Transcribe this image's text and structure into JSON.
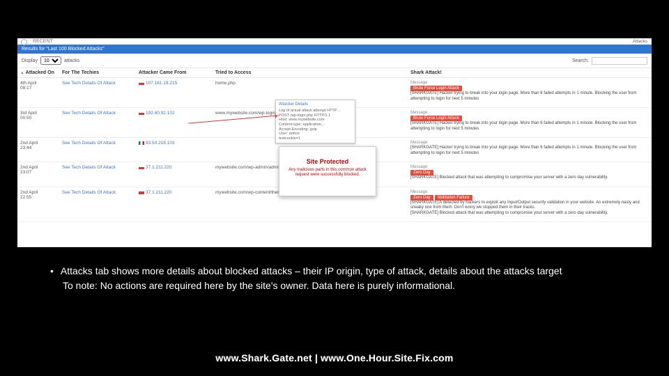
{
  "header": {
    "recent": "RECENT",
    "attack_count": "Attacks"
  },
  "blue_bar": {
    "title": "Results for \"Last 100 Blocked Attacks\""
  },
  "controls": {
    "display": "Display",
    "per_page": "10",
    "attacks": "attacks",
    "search_label": "Search:",
    "search_value": ""
  },
  "columns": {
    "attacked_on": "Attacked On",
    "for_techies": "For The Techies",
    "attacker_from": "Attacker Came From",
    "tried": "Tried to Access",
    "shark": "Shark Attack!"
  },
  "sort_icon": "▲",
  "rows": [
    {
      "date": "4th April\n08:17",
      "tech": "See Tech Details Of Attack",
      "flag": "us",
      "ip": "107.161.19.215",
      "tried": "home.php",
      "msg_label": "Message",
      "badges": [
        "Brute Force Login Attack"
      ],
      "msg": "[SHARKGATE] Hacker trying to break into your login page. More than 6 failed attempts in 1 minute. Blocking the user from attempting to login for next 5 minutes"
    },
    {
      "date": "3rd April\n00:50",
      "tech": "See Tech Details Of Attack",
      "flag": "us",
      "ip": "192.40.92.102",
      "tried": "www.mywebsite.com/wp-login.php",
      "msg_label": "Message",
      "badges": [
        "Brute Force Login Attack"
      ],
      "msg": "[SHARKGATE] Hacker trying to break into your login page. More than 6 failed attempts in 1 minute. Blocking the user from attempting to login for next 5 minutes"
    },
    {
      "date": "2nd April\n23:44",
      "tech": "See Tech Details Of Attack",
      "flag": "it",
      "ip": "93.50.218.103",
      "tried": "",
      "msg_label": "Message",
      "badges": [],
      "msg": "[SHARKGATE] Hacker trying to break into your login page. More than 6 failed attempts in 1 minute. Blocking the user from attempting to login for next 5 minutes"
    },
    {
      "date": "2nd April\n23:07",
      "tech": "See Tech Details Of Attack",
      "flag": "us",
      "ip": "37.1.211.220",
      "tried": "mywebsite.com/wp-admin/admin-ajax.php",
      "msg_label": "Message",
      "badges": [
        "Zero Day"
      ],
      "msg": "[SHARKGATE] Blocked attack that was attempting to compromise your server with a zero day vulnerability."
    },
    {
      "date": "2nd April\n22:55",
      "tech": "See Tech Details Of Attack",
      "flag": "us",
      "ip": "37.1.211.220",
      "tried": "mywebsite.com/wp-content/themes/dejavu/lib/scripts/dl-skin.php",
      "msg_label": "Message",
      "badges": [
        "Zero Day",
        "Validation Failure"
      ],
      "msg": "[SHARKGATE] A detected by hackers to exploit any Input/Output security validation in your website. An extremely nasty and sneaky one from them. Don't worry we stopped them in their tracks.\n[SHARKGATE] Blocked attack that was attempting to compromise your server with a zero day vulnerability."
    }
  ],
  "tooltip": {
    "head": "Attacker Details",
    "line1": "Log of actual attack attempt HTTP…",
    "line2": "POST /wp-login.php HTTP/1.1",
    "line3": "Host: www.mywebsite.com",
    "line4": "Content-type: application…",
    "line5": "Accept-Encoding: gzip",
    "line6": "User: admin",
    "line7": "testcookie=1"
  },
  "popup": {
    "title": "Site Protected",
    "body": "Any malicious parts in this common attack request were successfully blocked."
  },
  "bullets": {
    "line1": "Attacks tab shows more details about blocked attacks – their IP origin, type of attack, details about the attacks target",
    "line2": "To note: No actions are required here by the site's owner. Data here is purely informational."
  },
  "footer": "www.Shark.Gate.net | www.One.Hour.Site.Fix.com"
}
